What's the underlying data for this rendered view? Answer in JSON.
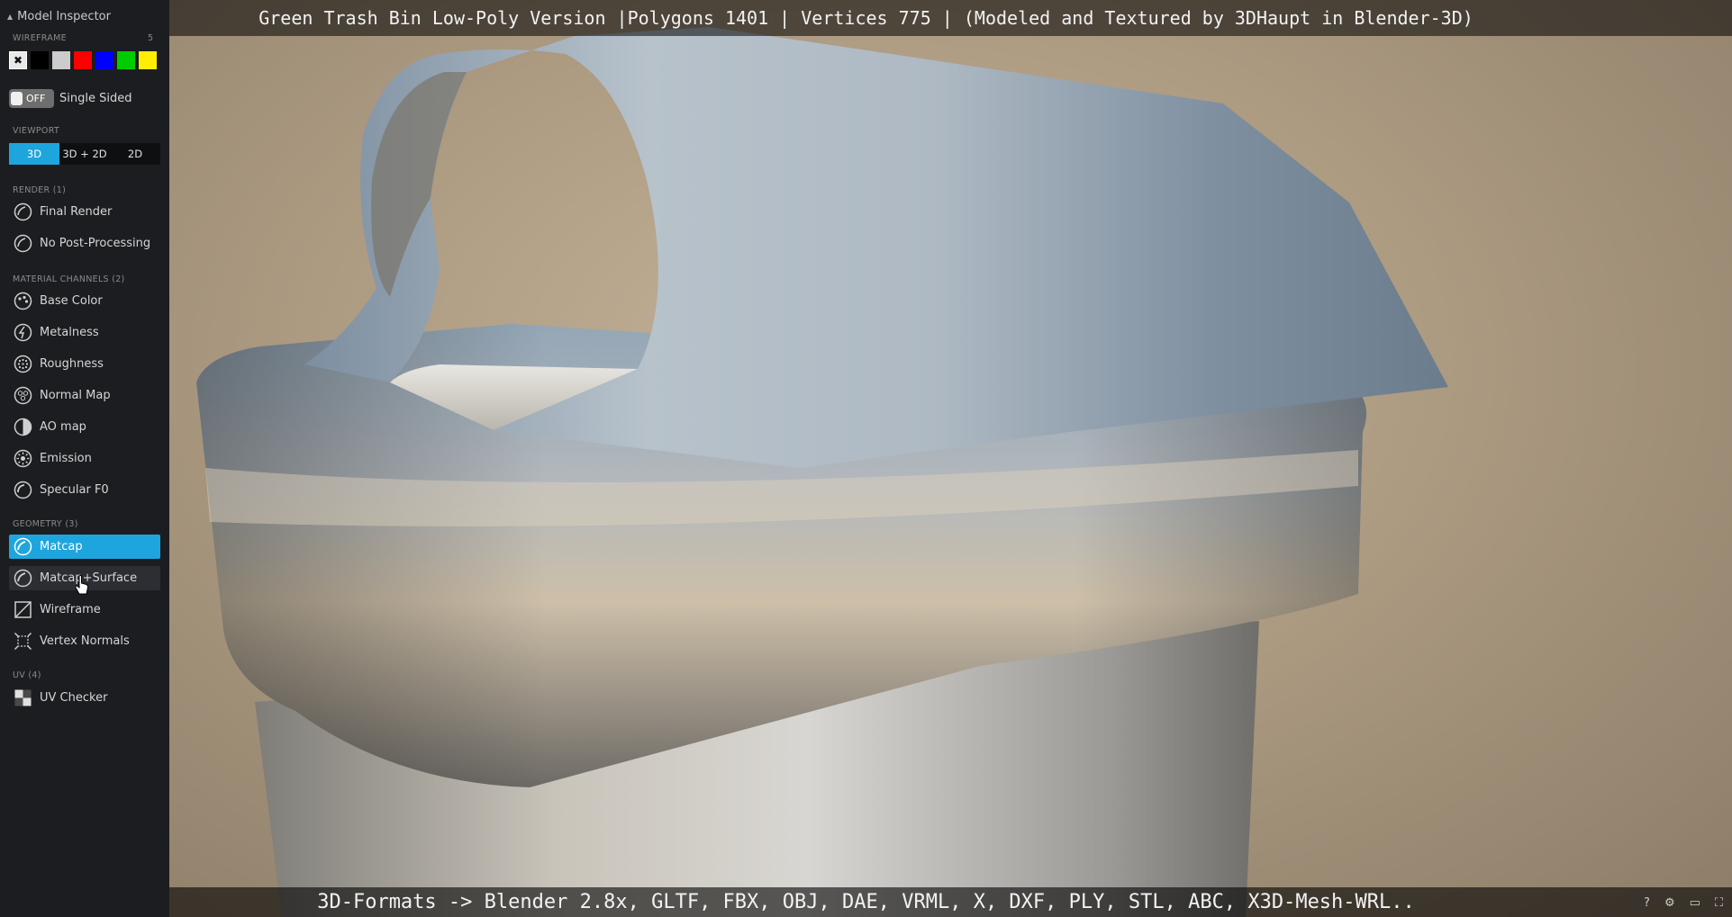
{
  "window": {
    "title": "Green Trash Bin Low-Poly Version |Polygons 1401 | Vertices 775 | (Modeled and Textured by 3DHaupt in Blender-3D)",
    "footer": "3D-Formats -> Blender 2.8x, GLTF, FBX, OBJ, DAE, VRML, X, DXF, PLY, STL, ABC, X3D-Mesh-WRL.."
  },
  "sidebar": {
    "header": "Model Inspector",
    "wireframe": {
      "label": "WIREFRAME",
      "count": "5",
      "colors": [
        "#e8e8e8",
        "#000000",
        "#cccccc",
        "#ff0000",
        "#0000ff",
        "#00cc00",
        "#ffee00"
      ]
    },
    "single_sided": {
      "toggle": "OFF",
      "label": "Single Sided"
    },
    "viewport": {
      "label": "VIEWPORT",
      "options": [
        "3D",
        "3D + 2D",
        "2D"
      ],
      "active": "3D"
    },
    "render": {
      "label": "RENDER (1)",
      "items": [
        {
          "label": "Final Render",
          "icon": "sphere-icon"
        },
        {
          "label": "No Post-Processing",
          "icon": "sphere-icon"
        }
      ]
    },
    "material_channels": {
      "label": "MATERIAL CHANNELS (2)",
      "items": [
        {
          "label": "Base Color",
          "icon": "palette-icon"
        },
        {
          "label": "Metalness",
          "icon": "metal-icon"
        },
        {
          "label": "Roughness",
          "icon": "roughness-icon"
        },
        {
          "label": "Normal Map",
          "icon": "normal-map-icon"
        },
        {
          "label": "AO map",
          "icon": "ao-icon"
        },
        {
          "label": "Emission",
          "icon": "emission-icon"
        },
        {
          "label": "Specular F0",
          "icon": "specular-icon"
        }
      ]
    },
    "geometry": {
      "label": "GEOMETRY (3)",
      "items": [
        {
          "label": "Matcap",
          "icon": "matcap-icon",
          "active": true
        },
        {
          "label": "Matcap+Surface",
          "icon": "matcap-surface-icon"
        },
        {
          "label": "Wireframe",
          "icon": "wireframe-icon"
        },
        {
          "label": "Vertex Normals",
          "icon": "vertex-normals-icon"
        }
      ]
    },
    "uv": {
      "label": "UV (4)",
      "items": [
        {
          "label": "UV Checker",
          "icon": "checker-icon"
        }
      ]
    }
  },
  "corner": {
    "help": "?"
  }
}
